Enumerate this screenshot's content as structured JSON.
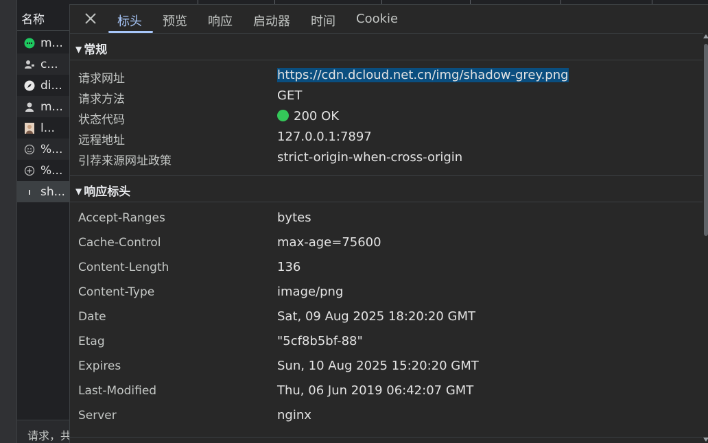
{
  "request_list": {
    "header": "名称",
    "items": [
      {
        "label": "m...",
        "icon": "message-icon",
        "icon_color": "#1ec960"
      },
      {
        "label": "c...",
        "icon": "user-tie-icon",
        "icon_color": "#cccccc"
      },
      {
        "label": "di...",
        "icon": "compass-icon",
        "icon_color": "#e8e8e8"
      },
      {
        "label": "m...",
        "icon": "person-icon",
        "icon_color": "#d0d0d0"
      },
      {
        "label": "l...",
        "icon": "photo-thumbnail-icon",
        "icon_color": "#c8a080"
      },
      {
        "label": "%...",
        "icon": "smiley-icon",
        "icon_color": "#bdbdbd"
      },
      {
        "label": "%...",
        "icon": "plus-circle-icon",
        "icon_color": "#bdbdbd"
      },
      {
        "label": "sh...",
        "icon": "image-sliver-icon",
        "icon_color": "#d0d0d0"
      }
    ],
    "footer": "请求，共"
  },
  "tabs": {
    "close_label": "✕",
    "items": [
      "标头",
      "预览",
      "响应",
      "启动器",
      "时间",
      "Cookie"
    ],
    "active": "标头",
    "active_color": "#a8c7fa"
  },
  "general": {
    "title": "常规",
    "rows": [
      {
        "key": "请求网址",
        "value": "https://cdn.dcloud.net.cn/img/shadow-grey.png"
      },
      {
        "key": "请求方法",
        "value": "GET"
      },
      {
        "key": "状态代码",
        "value": "200 OK"
      },
      {
        "key": "远程地址",
        "value": "127.0.0.1:7897"
      },
      {
        "key": "引荐来源网址政策",
        "value": "strict-origin-when-cross-origin"
      }
    ],
    "status_color": "#34c759"
  },
  "response_headers": {
    "title": "响应标头",
    "rows": [
      {
        "key": "Accept-Ranges",
        "value": "bytes"
      },
      {
        "key": "Cache-Control",
        "value": "max-age=75600"
      },
      {
        "key": "Content-Length",
        "value": "136"
      },
      {
        "key": "Content-Type",
        "value": "image/png"
      },
      {
        "key": "Date",
        "value": "Sat, 09 Aug 2025 18:20:20 GMT"
      },
      {
        "key": "Etag",
        "value": "\"5cf8b5bf-88\""
      },
      {
        "key": "Expires",
        "value": "Sun, 10 Aug 2025 15:20:20 GMT"
      },
      {
        "key": "Last-Modified",
        "value": "Thu, 06 Jun 2019 06:42:07 GMT"
      },
      {
        "key": "Server",
        "value": "nginx"
      }
    ]
  }
}
